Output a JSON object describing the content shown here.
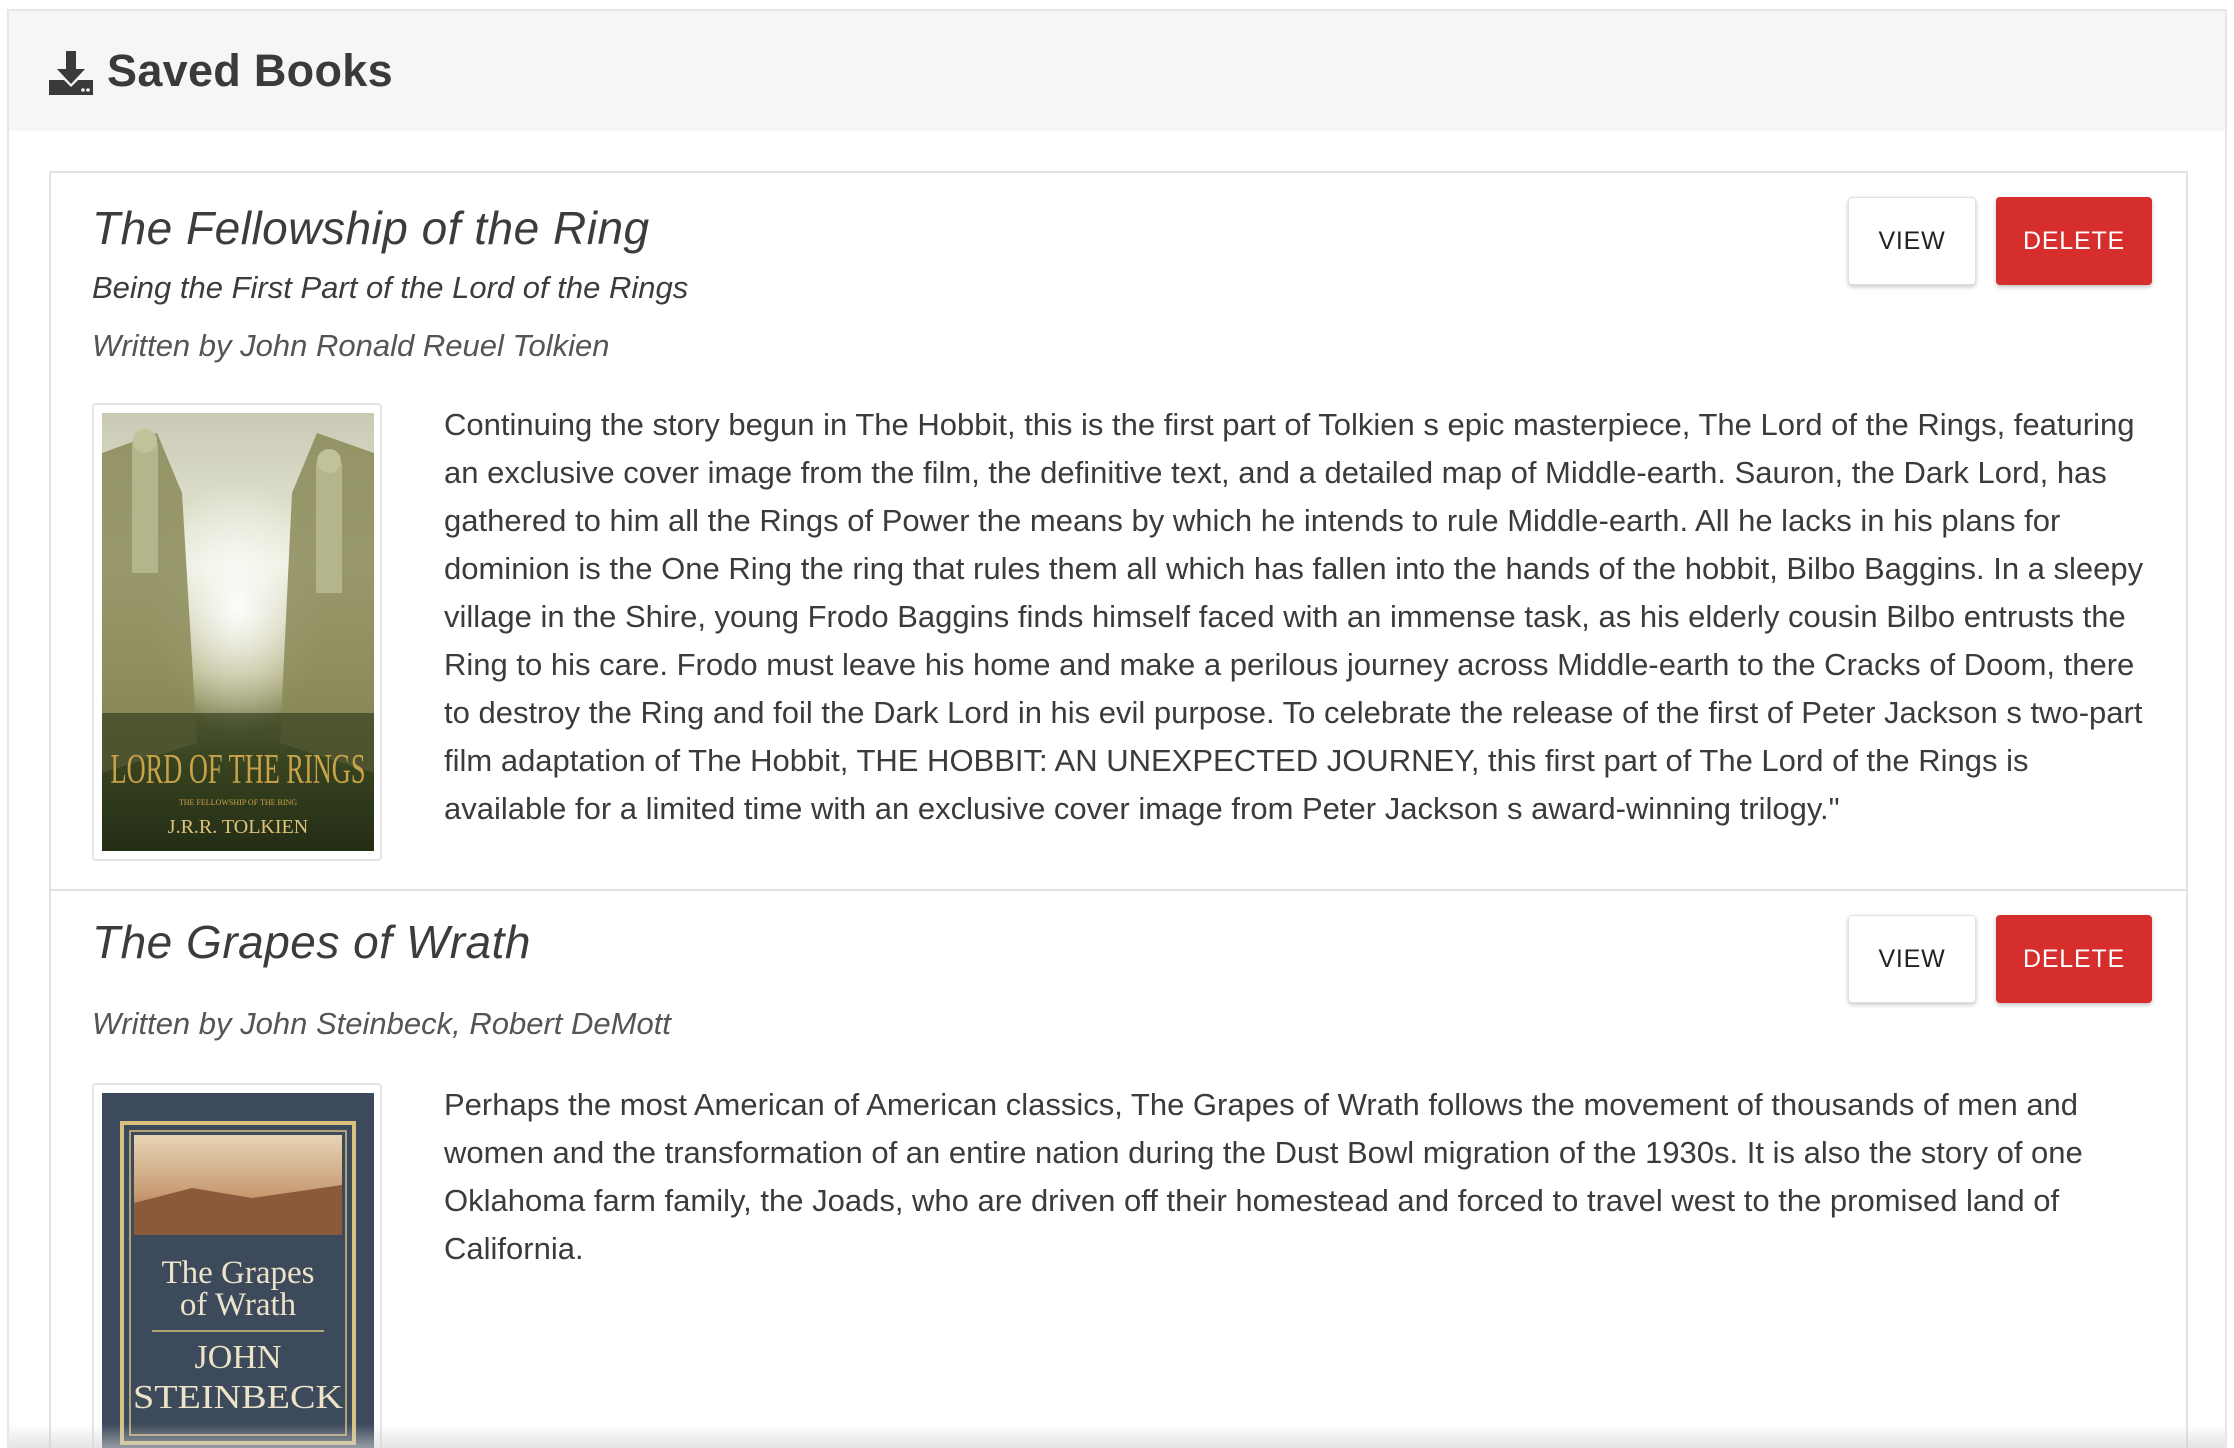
{
  "header": {
    "title": "Saved Books",
    "icon": "download-icon"
  },
  "books": [
    {
      "title": "The Fellowship of the Ring",
      "subtitle": "Being the First Part of the Lord of the Rings",
      "author": "Written by John Ronald Reuel Tolkien",
      "description": "Continuing the story begun in The Hobbit, this is the first part of Tolkien s epic masterpiece, The Lord of the Rings, featuring an exclusive cover image from the film, the definitive text, and a detailed map of Middle-earth. Sauron, the Dark Lord, has gathered to him all the Rings of Power the means by which he intends to rule Middle-earth. All he lacks in his plans for dominion is the One Ring the ring that rules them all which has fallen into the hands of the hobbit, Bilbo Baggins. In a sleepy village in the Shire, young Frodo Baggins finds himself faced with an immense task, as his elderly cousin Bilbo entrusts the Ring to his care. Frodo must leave his home and make a perilous journey across Middle-earth to the Cracks of Doom, there to destroy the Ring and foil the Dark Lord in his evil purpose. To celebrate the release of the first of Peter Jackson s two-part film adaptation of The Hobbit, THE HOBBIT: AN UNEXPECTED JOURNEY, this first part of The Lord of the Rings is available for a limited time with an exclusive cover image from Peter Jackson s award-winning trilogy.\"",
      "view_label": "VIEW",
      "delete_label": "DELETE",
      "cover": {
        "series": "LORD OF THE RINGS",
        "line": "THE FELLOWSHIP OF THE RING",
        "author": "J.R.R. TOLKIEN"
      }
    },
    {
      "title": "The Grapes of Wrath",
      "author": "Written by John Steinbeck, Robert DeMott",
      "description": "Perhaps the most American of American classics, The Grapes of Wrath follows the movement of thousands of men and women and the transformation of an entire nation during the Dust Bowl migration of the 1930s. It is also the story of one Oklahoma farm family, the Joads, who are driven off their homestead and forced to travel west to the promised land of California.",
      "view_label": "VIEW",
      "delete_label": "DELETE",
      "cover": {
        "title_line1": "The Grapes",
        "title_line2": "of Wrath",
        "author_line1": "JOHN",
        "author_line2": "STEINBECK"
      }
    }
  ],
  "colors": {
    "delete": "#d62d2d",
    "header_bg": "#f6f6f6"
  }
}
